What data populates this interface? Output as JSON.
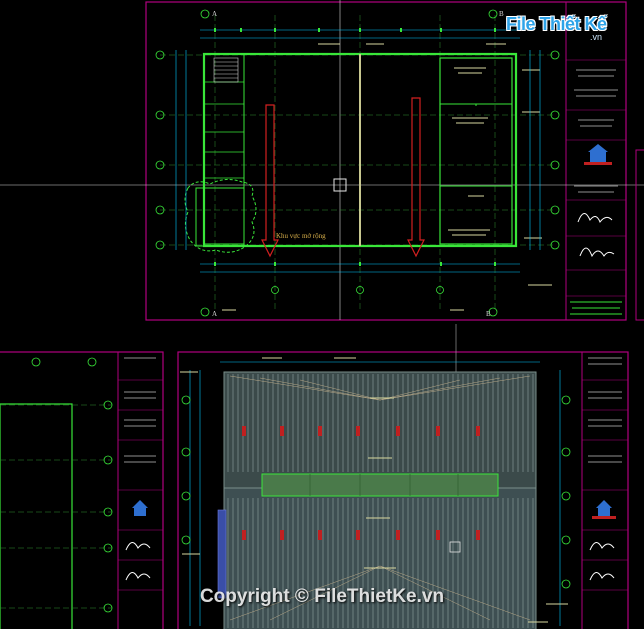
{
  "logo": {
    "brand": "File Thiết Kế",
    "tld": ".vn"
  },
  "watermark": {
    "text": "Copyright © FileThietKe.vn"
  },
  "upper_plan": {
    "area_label": "Khu vực mở rộng",
    "grid_letters": [
      "A",
      "B"
    ],
    "grid_numbers": [
      "1",
      "2",
      "3",
      "4",
      "5",
      "6",
      "7",
      "8"
    ]
  },
  "colors": {
    "background": "#000000",
    "wall": "#39e639",
    "grid": "#2f8f2f",
    "frame": "#b0007e",
    "dimension": "#00c8ff",
    "arrow": "#d22020",
    "roof": "#7a8e8a"
  }
}
